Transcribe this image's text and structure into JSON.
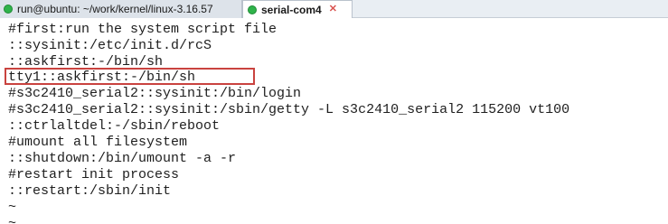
{
  "tabs": [
    {
      "label": "run@ubuntu: ~/work/kernel/linux-3.16.57",
      "active": false,
      "status_color": "#2fb34a"
    },
    {
      "label": "serial-com4",
      "active": true,
      "status_color": "#2fb34a"
    }
  ],
  "close_glyph": "✕",
  "terminal": {
    "lines": [
      "#first:run the system script file",
      "::sysinit:/etc/init.d/rcS",
      "::askfirst:-/bin/sh",
      "tty1::askfirst:-/bin/sh",
      "#s3c2410_serial2::sysinit:/bin/login",
      "#s3c2410_serial2::sysinit:/sbin/getty -L s3c2410_serial2 115200 vt100",
      "::ctrlaltdel:-/sbin/reboot",
      "#umount all filesystem",
      "::shutdown:/bin/umount -a -r",
      "#restart init process",
      "::restart:/sbin/init",
      "~",
      "~"
    ],
    "highlighted_line_index": 3,
    "highlight_color": "#c9433f"
  }
}
